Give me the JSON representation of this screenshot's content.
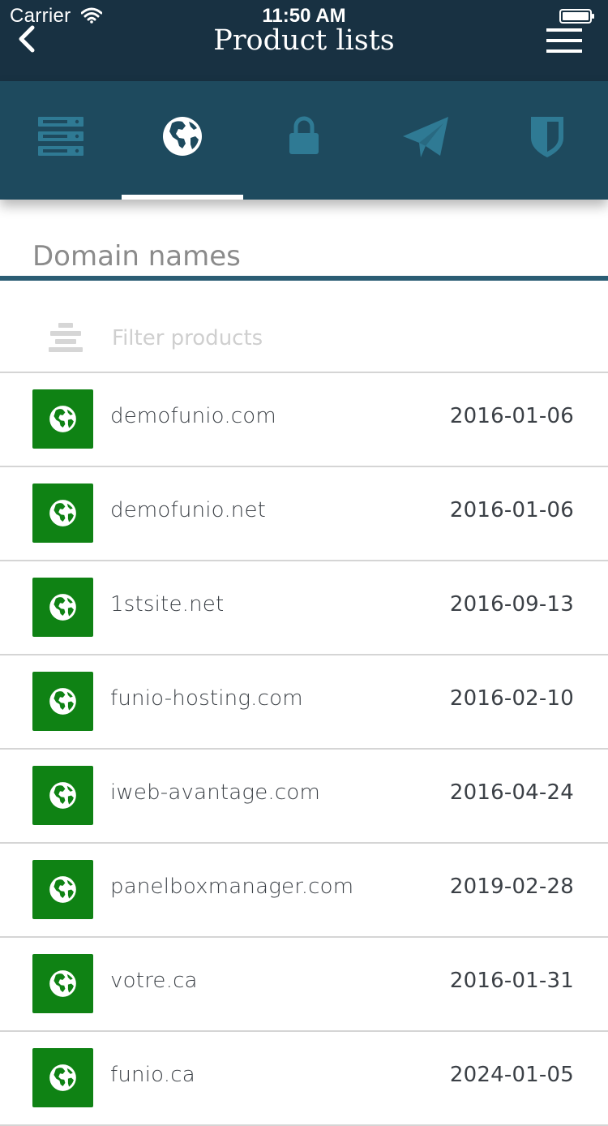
{
  "status_bar": {
    "carrier": "Carrier",
    "time": "11:50 AM"
  },
  "nav": {
    "title": "Product lists",
    "back_icon": "chevron-left-icon",
    "menu_icon": "hamburger-menu-icon"
  },
  "tabs": [
    {
      "icon": "server-icon",
      "active": false
    },
    {
      "icon": "globe-icon",
      "active": true
    },
    {
      "icon": "lock-icon",
      "active": false
    },
    {
      "icon": "paper-plane-icon",
      "active": false
    },
    {
      "icon": "shield-icon",
      "active": false
    }
  ],
  "section": {
    "title": "Domain names"
  },
  "filter": {
    "placeholder": "Filter products",
    "value": ""
  },
  "domains": [
    {
      "name": "demofunio.com",
      "date": "2016-01-06"
    },
    {
      "name": "demofunio.net",
      "date": "2016-01-06"
    },
    {
      "name": "1stsite.net",
      "date": "2016-09-13"
    },
    {
      "name": "funio-hosting.com",
      "date": "2016-02-10"
    },
    {
      "name": "iweb-avantage.com",
      "date": "2016-04-24"
    },
    {
      "name": "panelboxmanager.com",
      "date": "2019-02-28"
    },
    {
      "name": "votre.ca",
      "date": "2016-01-31"
    },
    {
      "name": "funio.ca",
      "date": "2024-01-05"
    }
  ],
  "colors": {
    "header_bg": "#183142",
    "tabbar_bg": "#1e4a5e",
    "inactive_tab_icon": "#2f7a94",
    "domain_icon_bg": "#0f8214"
  }
}
